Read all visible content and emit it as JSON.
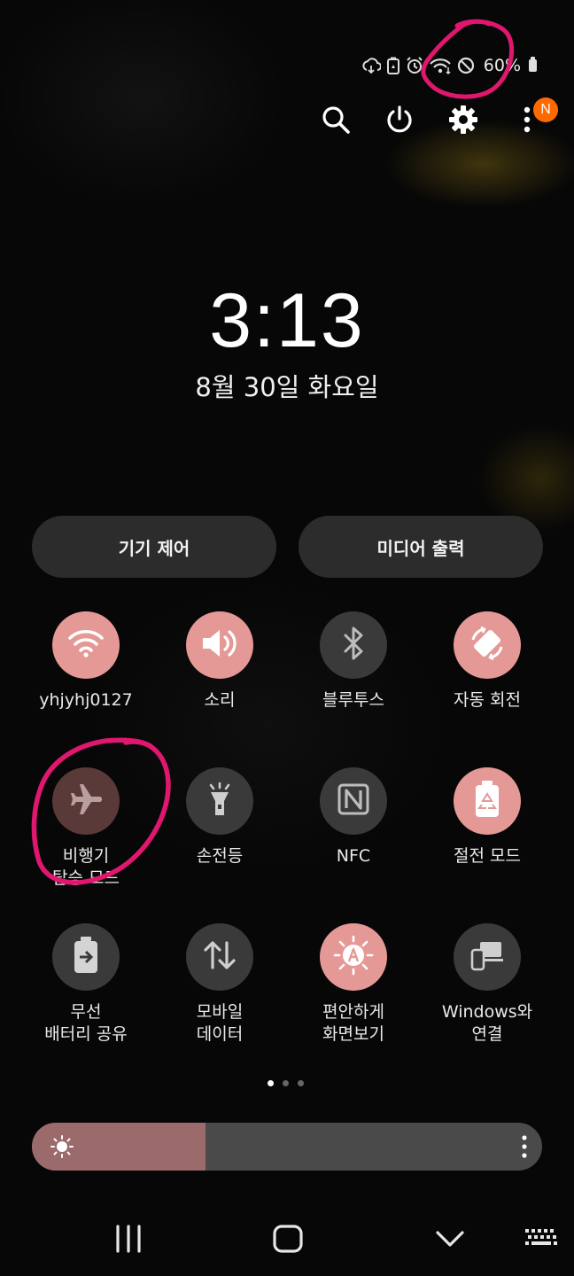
{
  "status_bar": {
    "icons": [
      "cloud-sync-icon",
      "battery-saver-icon",
      "alarm-icon",
      "wifi-icon",
      "do-not-disturb-icon"
    ],
    "battery_level": "60%"
  },
  "top_actions": {
    "icons": [
      "search-icon",
      "power-icon",
      "gear-icon",
      "more-vert-icon"
    ],
    "notification_badge": "N"
  },
  "clock": {
    "time": "3:13",
    "date": "8월 30일 화요일"
  },
  "pills": {
    "device_control": "기기 제어",
    "media_output": "미디어 출력"
  },
  "tiles": [
    {
      "label": "yhjyhj0127",
      "icon": "wifi-icon",
      "state": "on"
    },
    {
      "label": "소리",
      "icon": "volume-icon",
      "state": "on"
    },
    {
      "label": "블루투스",
      "icon": "bluetooth-icon",
      "state": "off"
    },
    {
      "label": "자동 회전",
      "icon": "auto-rotate-icon",
      "state": "on"
    },
    {
      "label": "비행기\n탑승 모드",
      "icon": "airplane-icon",
      "state": "dim"
    },
    {
      "label": "손전등",
      "icon": "flashlight-icon",
      "state": "off"
    },
    {
      "label": "NFC",
      "icon": "nfc-icon",
      "state": "off"
    },
    {
      "label": "절전 모드",
      "icon": "power-saving-icon",
      "state": "on"
    },
    {
      "label": "무선\n배터리 공유",
      "icon": "wireless-battery-share-icon",
      "state": "off"
    },
    {
      "label": "모바일\n데이터",
      "icon": "mobile-data-icon",
      "state": "off"
    },
    {
      "label": "편안하게\n화면보기",
      "icon": "eye-comfort-icon",
      "state": "on"
    },
    {
      "label": "Windows와\n연결",
      "icon": "link-to-windows-icon",
      "state": "off"
    }
  ],
  "pagination": {
    "pages": 3,
    "current": 1
  },
  "brightness": {
    "level_fraction": 0.34
  },
  "colors": {
    "tile_on": "#e59996",
    "tile_off": "#3a3a3a",
    "annotation": "#e0176f",
    "brightness_fill": "#9b6a6b",
    "badge": "#ff6a00"
  },
  "navbar": {
    "icons": [
      "recents-icon",
      "home-icon",
      "back-icon",
      "keyboard-icon"
    ]
  }
}
